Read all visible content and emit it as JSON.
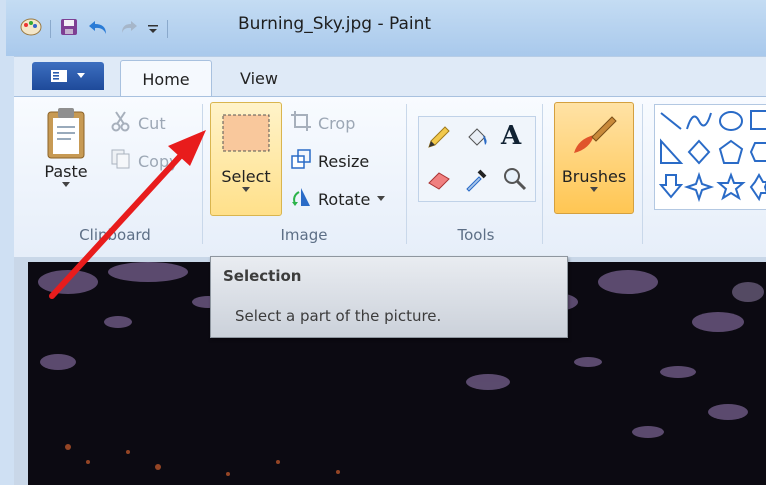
{
  "window": {
    "title": "Burning_Sky.jpg - Paint"
  },
  "tabs": [
    {
      "label": "Home",
      "active": true
    },
    {
      "label": "View",
      "active": false
    }
  ],
  "clipboard": {
    "paste_label": "Paste",
    "cut_label": "Cut",
    "copy_label": "Copy",
    "group_label": "Clipboard"
  },
  "image": {
    "select_label": "Select",
    "crop_label": "Crop",
    "resize_label": "Resize",
    "rotate_label": "Rotate",
    "group_label": "Image"
  },
  "tools": {
    "group_label": "Tools",
    "items": [
      "pencil-icon",
      "fill-icon",
      "text-icon",
      "eraser-icon",
      "color-picker-icon",
      "magnifier-icon"
    ]
  },
  "brushes": {
    "label": "Brushes"
  },
  "shapes": {
    "items": [
      "line-icon",
      "curve-icon",
      "oval-icon",
      "rectangle-icon",
      "right-triangle-icon",
      "diamond-icon",
      "pentagon-icon",
      "hexagon-icon",
      "down-arrow-icon",
      "four-point-star-icon",
      "five-point-star-icon",
      "six-point-star-icon"
    ]
  },
  "tooltip": {
    "title": "Selection",
    "description": "Select a part of the picture."
  },
  "colors": {
    "accent_arrow": "#e81c1c",
    "ribbon_bg": "#eef3fa",
    "tab_blue": "#2a5cae",
    "select_highlight": "#ffe08a"
  }
}
